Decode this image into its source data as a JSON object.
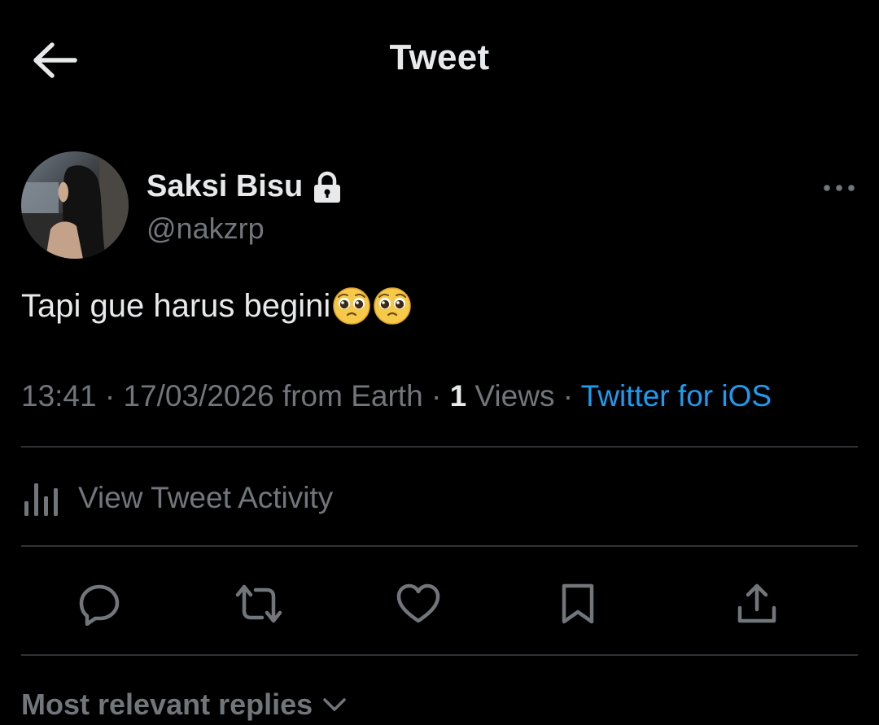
{
  "header": {
    "title": "Tweet",
    "back_icon": "arrow-left-icon"
  },
  "author": {
    "display_name": "Saksi Bisu",
    "handle": "@nakzrp",
    "protected_icon": "lock-icon",
    "more_icon": "more-horizontal-icon"
  },
  "tweet": {
    "text": "Tapi gue harus begini",
    "emoji": "pleading-face-icon"
  },
  "meta": {
    "time": "13:41",
    "sep1": " · ",
    "date_location": "17/03/2026 from Earth",
    "sep2": " · ",
    "views_count": "1",
    "views_label": " Views",
    "sep3": " · ",
    "source": "Twitter for iOS"
  },
  "activity": {
    "label": "View Tweet Activity",
    "icon": "bar-chart-icon"
  },
  "actions": {
    "reply_icon": "reply-icon",
    "retweet_icon": "retweet-icon",
    "like_icon": "heart-icon",
    "bookmark_icon": "bookmark-icon",
    "share_icon": "share-icon"
  },
  "replies": {
    "label": "Most relevant replies",
    "icon": "chevron-down-icon"
  },
  "colors": {
    "background": "#000000",
    "text": "#e7e9ea",
    "secondary": "#71767b",
    "divider": "#2f3336",
    "link": "#1d9bf0"
  }
}
